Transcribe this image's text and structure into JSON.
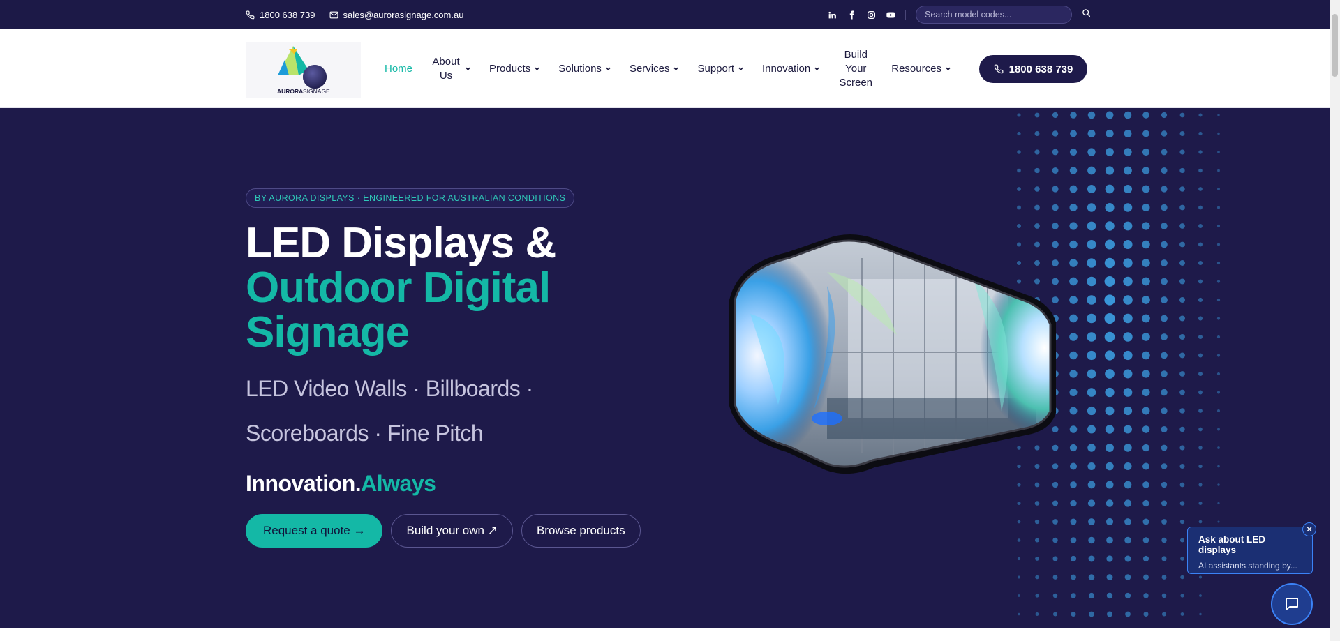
{
  "topbar": {
    "phone": "1800 638 739",
    "email": "sales@aurorasignage.com.au",
    "social": [
      "linkedin-icon",
      "facebook-icon",
      "instagram-icon",
      "youtube-icon"
    ],
    "search_placeholder": "Search model codes..."
  },
  "logo": {
    "word1": "AURORA",
    "word2": "SIGNAGE"
  },
  "nav": {
    "items": [
      {
        "label": "Home",
        "active": true
      },
      {
        "label": "About Us",
        "dropdown": true
      },
      {
        "label": "Products",
        "dropdown": true
      },
      {
        "label": "Solutions",
        "dropdown": true
      },
      {
        "label": "Services",
        "dropdown": true
      },
      {
        "label": "Support",
        "dropdown": true
      },
      {
        "label": "Innovation",
        "dropdown": true
      },
      {
        "label": "Build Your Screen"
      },
      {
        "label": "Resources",
        "dropdown": true
      }
    ],
    "cta_phone": "1800 638 739"
  },
  "hero": {
    "badge": "BY AURORA DISPLAYS · ENGINEERED FOR AUSTRALIAN CONDITIONS",
    "title_line1": "LED Displays &",
    "title_line2": "Outdoor Digital",
    "title_line3": "Signage",
    "subtitle": "LED Video Walls · Billboards · Scoreboards · Fine Pitch",
    "tagline_white": "Innovation.",
    "tagline_teal": "Always",
    "btn_quote": "Request a quote →",
    "btn_build": "Build your own ↗",
    "btn_browse": "Browse products"
  },
  "chat": {
    "title": "Ask about LED displays",
    "subtitle": "AI assistants standing by...",
    "close": "✕"
  },
  "colors": {
    "navy": "#1e1a4a",
    "teal": "#14b8a6",
    "chat_blue": "#3b82f6"
  }
}
